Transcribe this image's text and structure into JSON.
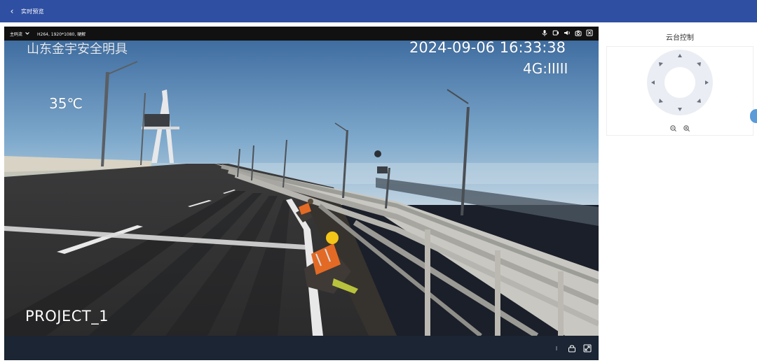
{
  "header": {
    "title": "实时预览"
  },
  "player": {
    "stream_label": "主码流",
    "codec_info": "H264, 1920*1080, 硬解",
    "osd": {
      "location": "山东金宇安全明具",
      "datetime": "2024-09-06 16:33:38",
      "signal": "4G:IIIII",
      "temperature": "35℃",
      "project": "PROJECT_1"
    }
  },
  "panel": {
    "title": "云台控制"
  },
  "colors": {
    "header": "#2f4fa2",
    "player_bg": "#1a1f29",
    "bottom_bar": "#1b2533"
  }
}
